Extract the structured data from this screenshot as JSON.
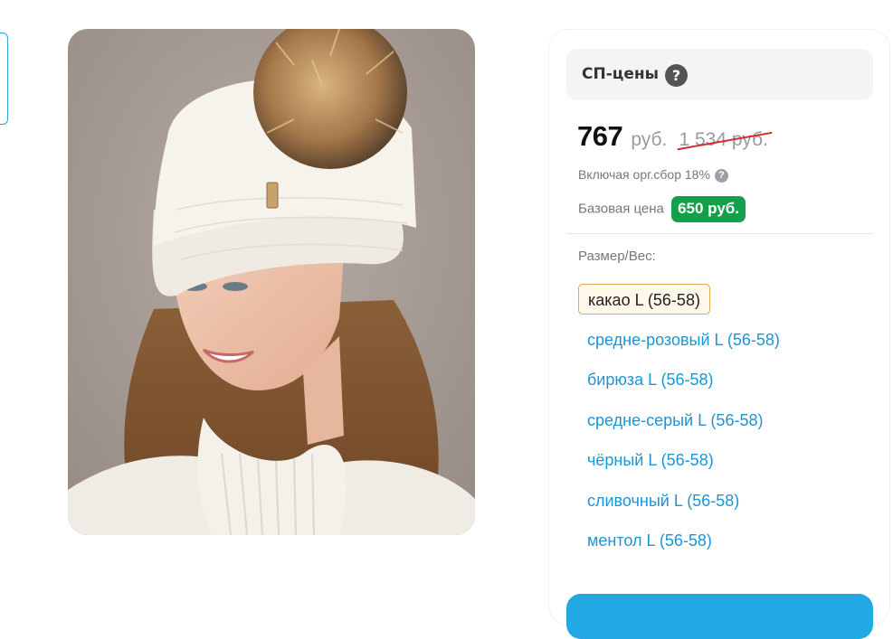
{
  "product": {
    "image_alt": "woman in white knit hat with fur pompom"
  },
  "sp_panel": {
    "title": "СП-цены",
    "help_icon": "?"
  },
  "price": {
    "current": "767",
    "currency": "руб.",
    "old": "1 534 руб."
  },
  "fee": {
    "text": "Включая орг.сбор 18%",
    "icon": "?"
  },
  "base_price": {
    "label": "Базовая цена",
    "value": "650 руб."
  },
  "size": {
    "label": "Размер/Вес:",
    "options": [
      {
        "label": "какао L (56-58)",
        "selected": true
      },
      {
        "label": "средне-розовый L (56-58)",
        "selected": false
      },
      {
        "label": "бирюза L (56-58)",
        "selected": false
      },
      {
        "label": "средне-серый L (56-58)",
        "selected": false
      },
      {
        "label": "чёрный L (56-58)",
        "selected": false
      },
      {
        "label": "сливочный L (56-58)",
        "selected": false
      },
      {
        "label": "ментол L (56-58)",
        "selected": false
      }
    ]
  },
  "colors": {
    "accent": "#22a8e3",
    "link": "#1a95d6",
    "badge_green": "#12a04a",
    "strike_red": "#d12b2b",
    "selected_border": "#e3a94f"
  }
}
